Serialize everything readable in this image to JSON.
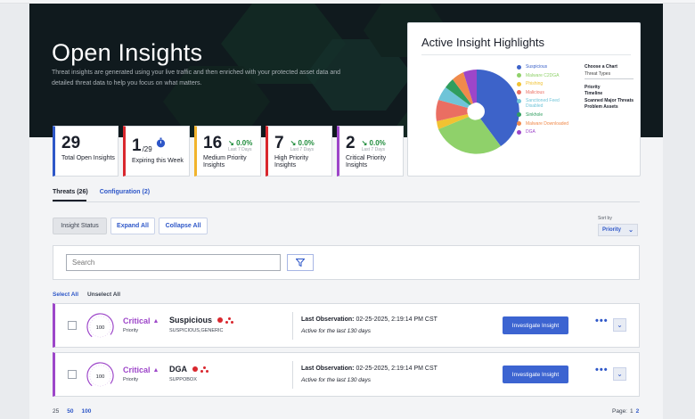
{
  "hero": {
    "title": "Open Insights",
    "subtitle": "Threat insights are generated using your live traffic and then enriched with your protected asset data and detailed threat data to help you focus on what matters."
  },
  "kpis": [
    {
      "value": "29",
      "label": "Total Open Insights",
      "color": "#2e57c8"
    },
    {
      "value": "1",
      "suffix": "/29",
      "label": "Expiring this Week",
      "color": "#d9272e",
      "icon": "stopwatch-icon"
    },
    {
      "value": "16",
      "delta": "0.0%",
      "delta_label": "Last 7 Days",
      "label": "Medium Priority Insights",
      "color": "#f1b32b"
    },
    {
      "value": "7",
      "delta": "0.0%",
      "delta_label": "Last 7 Days",
      "label": "High Priority Insights",
      "color": "#d9272e"
    },
    {
      "value": "2",
      "delta": "0.0%",
      "delta_label": "Last 7 Days",
      "label": "Critical Priority Insights",
      "color": "#9d46c9"
    }
  ],
  "highlights": {
    "title": "Active Insight Highlights",
    "legend": [
      {
        "label": "Suspicious",
        "color": "#3d63c9"
      },
      {
        "label": "Malware C2DGA",
        "color": "#8fd16a"
      },
      {
        "label": "Phishing",
        "color": "#f1c232"
      },
      {
        "label": "Malicious",
        "color": "#ea6e62"
      },
      {
        "label": "Sanctioned Feed Disabled",
        "color": "#6fc4d8"
      },
      {
        "label": "Sinkhole",
        "color": "#2f9d5e"
      },
      {
        "label": "Malware Downloaded",
        "color": "#f08a4b"
      },
      {
        "label": "DGA",
        "color": "#9d46c9"
      }
    ],
    "choose_title": "Choose a Chart",
    "choose_selected": "Threat Types",
    "choose_options": [
      "Priority",
      "Timeline",
      "Scanned Major Threats",
      "Problem Assets"
    ]
  },
  "tabs": {
    "threats": "Threats (26)",
    "configuration": "Configuration (2)"
  },
  "toolbar": {
    "insight_status": "Insight Status",
    "expand_all": "Expand All",
    "collapse_all": "Collapse All"
  },
  "sort": {
    "label": "Sort by",
    "value": "Priority"
  },
  "search": {
    "placeholder": "Search"
  },
  "selection": {
    "select_all": "Select All",
    "unselect_all": "Unselect All"
  },
  "rows": [
    {
      "score": "100",
      "severity": "Critical",
      "priority_label": "Priority",
      "name": "Suspicious",
      "sub": "SUSPICIOUS,GENERIC",
      "last_obs_label": "Last Observation:",
      "last_obs": "02-25-2025, 2:19:14 PM CST",
      "active": "Active for the last 130 days",
      "button": "Investigate Insight"
    },
    {
      "score": "100",
      "severity": "Critical",
      "priority_label": "Priority",
      "name": "DGA",
      "sub": "SUPPOBOX",
      "last_obs_label": "Last Observation:",
      "last_obs": "02-25-2025, 2:19:14 PM CST",
      "active": "Active for the last 130 days",
      "button": "Investigate Insight"
    }
  ],
  "pager": {
    "sizes": [
      "25",
      "50",
      "100"
    ],
    "page_label": "Page:",
    "pages": [
      "1",
      "2"
    ]
  }
}
